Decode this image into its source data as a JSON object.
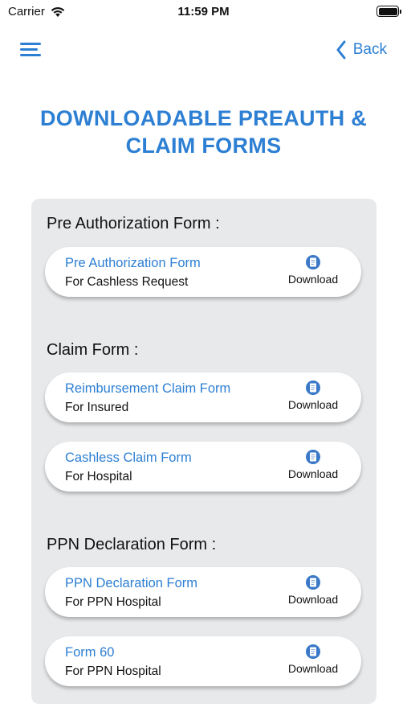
{
  "status_bar": {
    "carrier": "Carrier",
    "time": "11:59 PM"
  },
  "nav": {
    "back_label": "Back",
    "menu_icon": "hamburger-menu-icon",
    "back_icon": "chevron-left-icon"
  },
  "page_title": {
    "line1": "DOWNLOADABLE PREAUTH &",
    "line2": "CLAIM FORMS"
  },
  "colors": {
    "accent": "#2d7fd3",
    "panel_bg": "#e7e9eb",
    "card_bg": "#ffffff"
  },
  "sections": [
    {
      "heading": "Pre Authorization Form :",
      "forms": [
        {
          "title": "Pre Authorization Form",
          "subtitle": "For Cashless Request",
          "action": "Download",
          "icon": "document-download-icon"
        }
      ]
    },
    {
      "heading": "Claim Form :",
      "forms": [
        {
          "title": "Reimbursement Claim Form",
          "subtitle": "For Insured",
          "action": "Download",
          "icon": "document-download-icon"
        },
        {
          "title": "Cashless Claim Form",
          "subtitle": "For Hospital",
          "action": "Download",
          "icon": "document-download-icon"
        }
      ]
    },
    {
      "heading": "PPN Declaration Form :",
      "forms": [
        {
          "title": "PPN Declaration Form",
          "subtitle": "For PPN Hospital",
          "action": "Download",
          "icon": "document-download-icon"
        },
        {
          "title": "Form 60",
          "subtitle": "For PPN Hospital",
          "action": "Download",
          "icon": "document-download-icon"
        }
      ]
    }
  ]
}
